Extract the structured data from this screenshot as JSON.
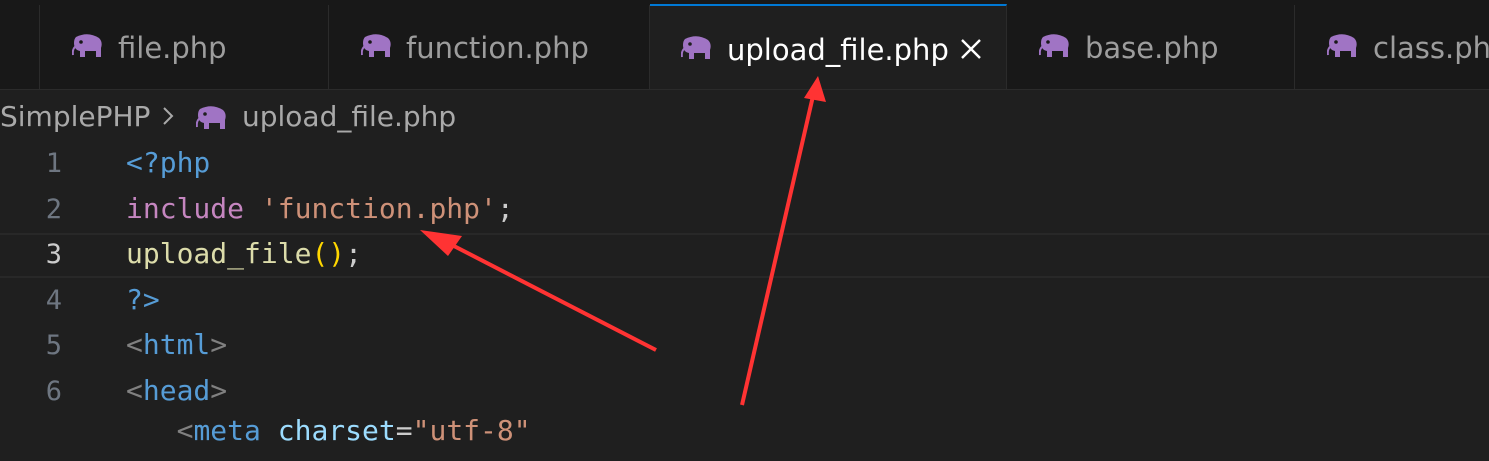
{
  "tabs": [
    {
      "label": "file.php",
      "icon": "php-elephant-icon",
      "active": false
    },
    {
      "label": "function.php",
      "icon": "php-elephant-icon",
      "active": false
    },
    {
      "label": "upload_file.php",
      "icon": "php-elephant-icon",
      "active": true
    },
    {
      "label": "base.php",
      "icon": "php-elephant-icon",
      "active": false
    },
    {
      "label": "class.php",
      "icon": "php-elephant-icon",
      "active": false
    }
  ],
  "breadcrumb": {
    "folder": "SimplePHP",
    "file": "upload_file.php"
  },
  "editor": {
    "current_line": 3,
    "lines": [
      {
        "number": "1",
        "tokens": [
          "<?php"
        ]
      },
      {
        "number": "2",
        "tokens": [
          "include",
          " ",
          "'function.php'",
          ";"
        ]
      },
      {
        "number": "3",
        "tokens": [
          "upload_file",
          "(",
          ")",
          ";"
        ]
      },
      {
        "number": "4",
        "tokens": [
          "?>"
        ]
      },
      {
        "number": "5",
        "tokens": [
          "<",
          "html",
          ">"
        ]
      },
      {
        "number": "6",
        "tokens": [
          "<",
          "head",
          ">"
        ]
      }
    ]
  },
  "colors": {
    "php_icon": "#a074c4",
    "annotation_arrow": "#ff3333",
    "active_tab_border": "#0078d4"
  }
}
